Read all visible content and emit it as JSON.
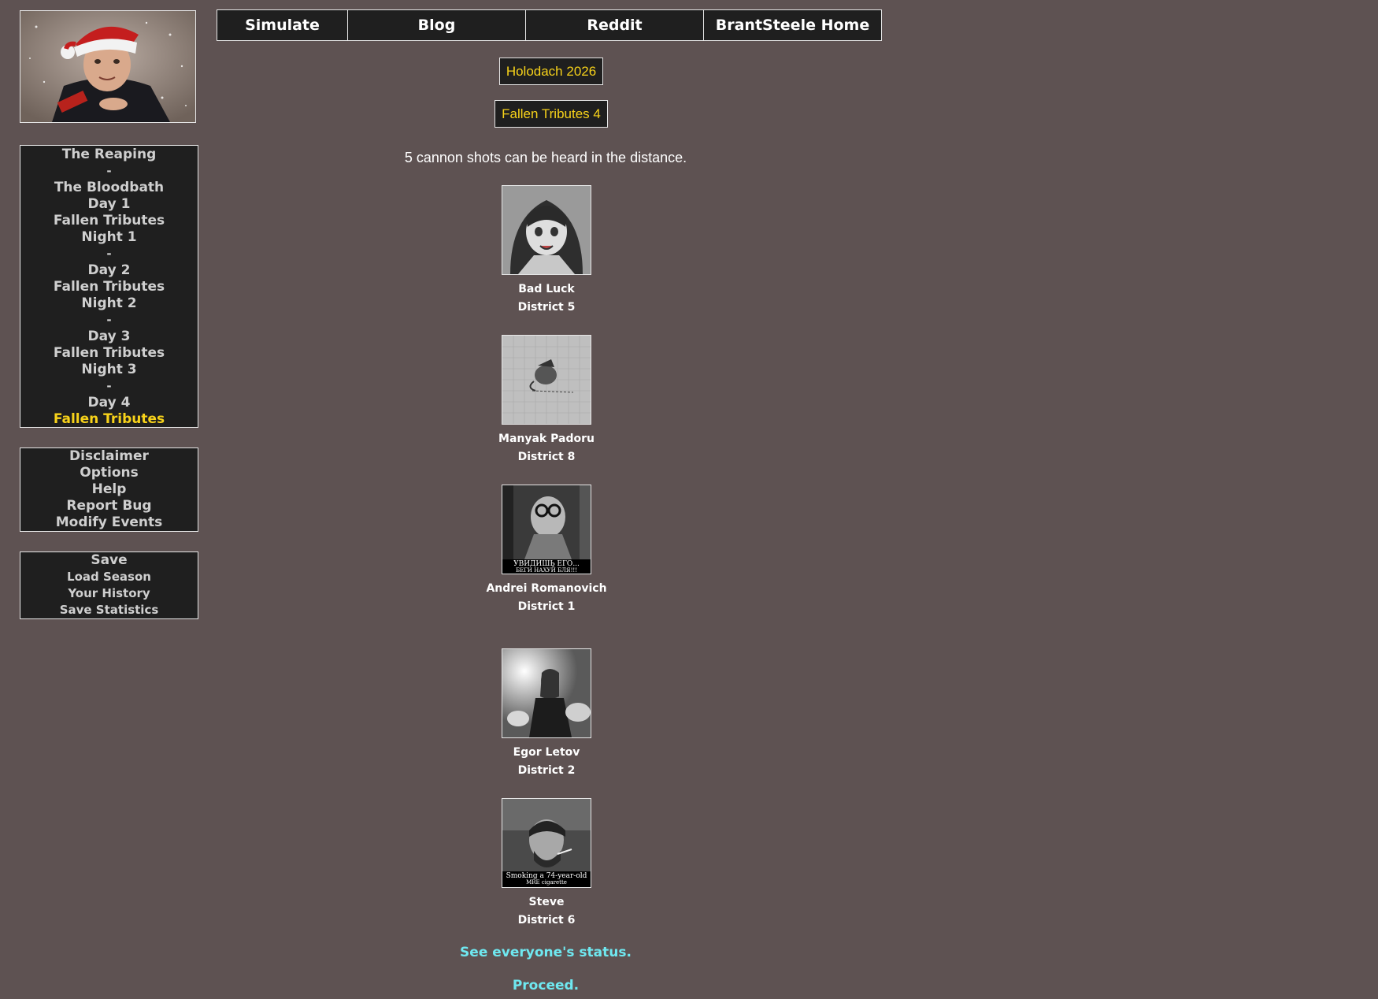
{
  "nav": {
    "tabs": [
      {
        "label": "Simulate"
      },
      {
        "label": "Blog"
      },
      {
        "label": "Reddit"
      },
      {
        "label": "BrantSteele Home"
      }
    ]
  },
  "sidebar": {
    "rounds": [
      {
        "label": "The Reaping"
      },
      {
        "label": "-",
        "separator": true
      },
      {
        "label": "The Bloodbath"
      },
      {
        "label": "Day 1"
      },
      {
        "label": "Fallen Tributes"
      },
      {
        "label": "Night 1"
      },
      {
        "label": "-",
        "separator": true
      },
      {
        "label": "Day 2"
      },
      {
        "label": "Fallen Tributes"
      },
      {
        "label": "Night 2"
      },
      {
        "label": "-",
        "separator": true
      },
      {
        "label": "Day 3"
      },
      {
        "label": "Fallen Tributes"
      },
      {
        "label": "Night 3"
      },
      {
        "label": "-",
        "separator": true
      },
      {
        "label": "Day 4"
      },
      {
        "label": "Fallen Tributes",
        "active": true
      }
    ],
    "utility": [
      {
        "label": "Disclaimer"
      },
      {
        "label": "Options"
      },
      {
        "label": "Help"
      },
      {
        "label": "Report Bug"
      },
      {
        "label": "Modify Events"
      }
    ],
    "save": [
      {
        "label": "Save"
      },
      {
        "label": "Load Season"
      },
      {
        "label": "Your History"
      },
      {
        "label": "Save Statistics"
      }
    ]
  },
  "main": {
    "season_title": "Holodach 2026",
    "round_title": "Fallen Tributes 4",
    "message": "5 cannon shots can be heard in the distance.",
    "tributes": [
      {
        "name": "Bad Luck",
        "district": "District 5"
      },
      {
        "name": "Manyak Padoru",
        "district": "District 8"
      },
      {
        "name": "Andrei Romanovich",
        "district": "District 1"
      },
      {
        "name": "Egor Letov",
        "district": "District 2"
      },
      {
        "name": "Steve",
        "district": "District 6"
      }
    ],
    "status_link": "See everyone's status.",
    "proceed_link": "Proceed."
  },
  "portrait_captions": {
    "andrei": [
      "УВИДИШЬ ЕГО...",
      "БЕГИ НАХУЙ БЛЯ!!!"
    ],
    "steve": [
      "Smoking a 74-year-old",
      "MRE cigarette"
    ]
  },
  "colors": {
    "background": "#5e5252",
    "panel": "#1f1f1f",
    "active": "#f7d21a",
    "link": "#6fe8f0"
  }
}
